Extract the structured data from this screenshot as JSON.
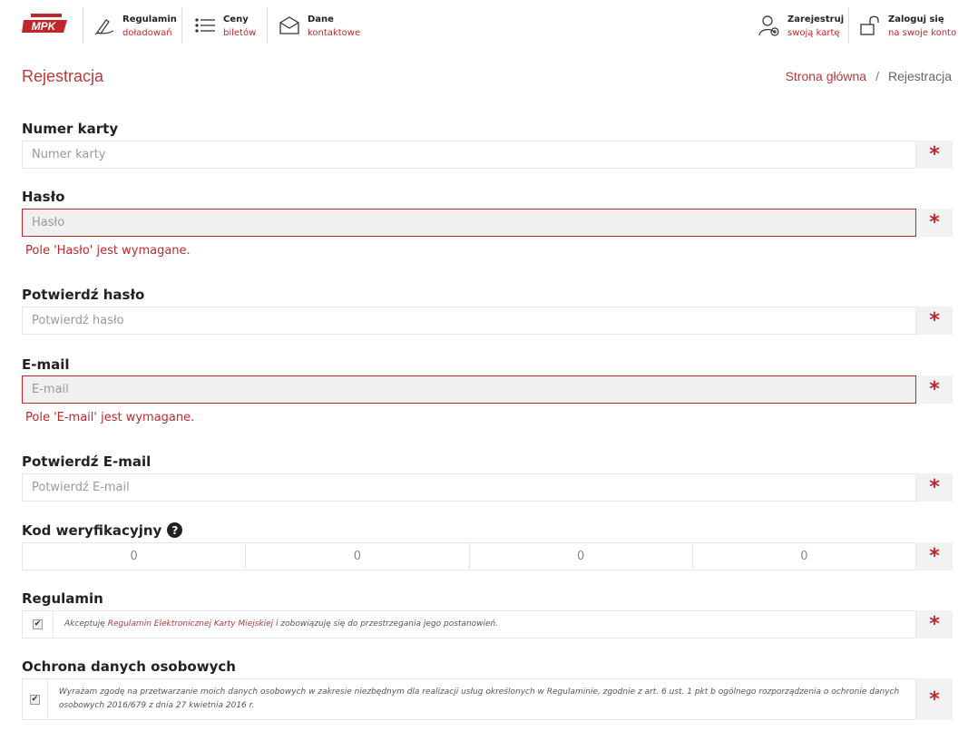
{
  "header": {
    "nav": [
      {
        "title": "Regulamin",
        "sub": "doładowań",
        "icon": "pen-icon"
      },
      {
        "title": "Ceny",
        "sub": "biletów",
        "icon": "list-icon"
      },
      {
        "title": "Dane",
        "sub": "kontaktowe",
        "icon": "envelope-icon"
      }
    ],
    "register": {
      "title": "Zarejestruj",
      "sub": "swoją kartę",
      "icon": "user-add-icon"
    },
    "login": {
      "title": "Zaloguj się",
      "sub": "na swoje konto",
      "icon": "unlock-icon"
    },
    "logo_text": "MPK"
  },
  "page": {
    "title": "Rejestracja",
    "breadcrumb": {
      "home": "Strona główna",
      "separator": "/",
      "current": "Rejestracja"
    }
  },
  "form": {
    "card_number": {
      "label": "Numer karty",
      "placeholder": "Numer karty"
    },
    "password": {
      "label": "Hasło",
      "placeholder": "Hasło",
      "error": "Pole 'Hasło' jest wymagane."
    },
    "confirm_password": {
      "label": "Potwierdź hasło",
      "placeholder": "Potwierdź hasło"
    },
    "email": {
      "label": "E-mail",
      "placeholder": "E-mail",
      "error": "Pole 'E-mail' jest wymagane."
    },
    "confirm_email": {
      "label": "Potwierdź E-mail",
      "placeholder": "Potwierdź E-mail"
    },
    "verification": {
      "label": "Kod weryfikacyjny",
      "help": "?",
      "digits": [
        "0",
        "0",
        "0",
        "0"
      ]
    },
    "terms": {
      "label": "Regulamin",
      "text_before": "Akceptuję ",
      "link": "Regulamin Elektronicznej Karty Miejskiej",
      "text_after": " i zobowiązuję się do przestrzegania jego postanowień.",
      "checked": "✔"
    },
    "privacy": {
      "label": "Ochrona danych osobowych",
      "text": "Wyrażam zgodę na przetwarzanie moich danych osobowych w zakresie niezbędnym dla realizacji usług określonych w Regulaminie, zgodnie z art. 6 ust. 1 pkt b ogólnego rozporządzenia o ochronie danych osobowych 2016/679 z dnia 27 kwietnia 2016 r.",
      "checked": "✔"
    },
    "required_mark": "*"
  },
  "colors": {
    "accent": "#c0272d",
    "title": "#b53a3a"
  }
}
